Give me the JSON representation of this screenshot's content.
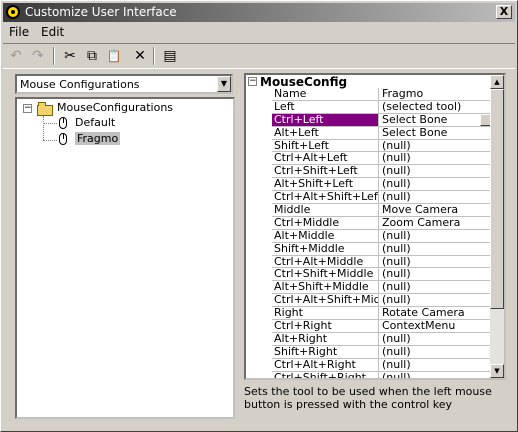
{
  "window": {
    "title": "Customize User Interface",
    "close_glyph": "X"
  },
  "menu": {
    "items": [
      "File",
      "Edit"
    ]
  },
  "toolbar": {
    "undo": "↶",
    "redo": "↷",
    "cut": "✂",
    "copy": "⧉",
    "paste": "📋",
    "delete": "✕",
    "props": "▤"
  },
  "config_select": {
    "value": "Mouse Configurations"
  },
  "tree": {
    "root": "MouseConfigurations",
    "children": [
      {
        "label": "Default"
      },
      {
        "label": "Fragmo",
        "selected": true
      }
    ]
  },
  "grid": {
    "section": "MouseConfig",
    "rows": [
      {
        "name": "Name",
        "value": "Fragmo"
      },
      {
        "name": "Left",
        "value": "(selected tool)"
      },
      {
        "name": "Ctrl+Left",
        "value": "Select Bone",
        "selected": true
      },
      {
        "name": "Alt+Left",
        "value": "Select Bone"
      },
      {
        "name": "Shift+Left",
        "value": "(null)"
      },
      {
        "name": "Ctrl+Alt+Left",
        "value": "(null)"
      },
      {
        "name": "Ctrl+Shift+Left",
        "value": "(null)"
      },
      {
        "name": "Alt+Shift+Left",
        "value": "(null)"
      },
      {
        "name": "Ctrl+Alt+Shift+Left",
        "value": "(null)"
      },
      {
        "name": "Middle",
        "value": "Move Camera"
      },
      {
        "name": "Ctrl+Middle",
        "value": "Zoom Camera"
      },
      {
        "name": "Alt+Middle",
        "value": "(null)"
      },
      {
        "name": "Shift+Middle",
        "value": "(null)"
      },
      {
        "name": "Ctrl+Alt+Middle",
        "value": "(null)"
      },
      {
        "name": "Ctrl+Shift+Middle",
        "value": "(null)"
      },
      {
        "name": "Alt+Shift+Middle",
        "value": "(null)"
      },
      {
        "name": "Ctrl+Alt+Shift+Middle",
        "value": "(null)"
      },
      {
        "name": "Right",
        "value": "Rotate Camera"
      },
      {
        "name": "Ctrl+Right",
        "value": "ContextMenu"
      },
      {
        "name": "Alt+Right",
        "value": "(null)"
      },
      {
        "name": "Shift+Right",
        "value": "(null)"
      },
      {
        "name": "Ctrl+Alt+Right",
        "value": "(null)"
      },
      {
        "name": "Ctrl+Shift+Right",
        "value": "(null)"
      }
    ]
  },
  "description": "Sets the tool to be used when the left mouse button is pressed with the control key"
}
